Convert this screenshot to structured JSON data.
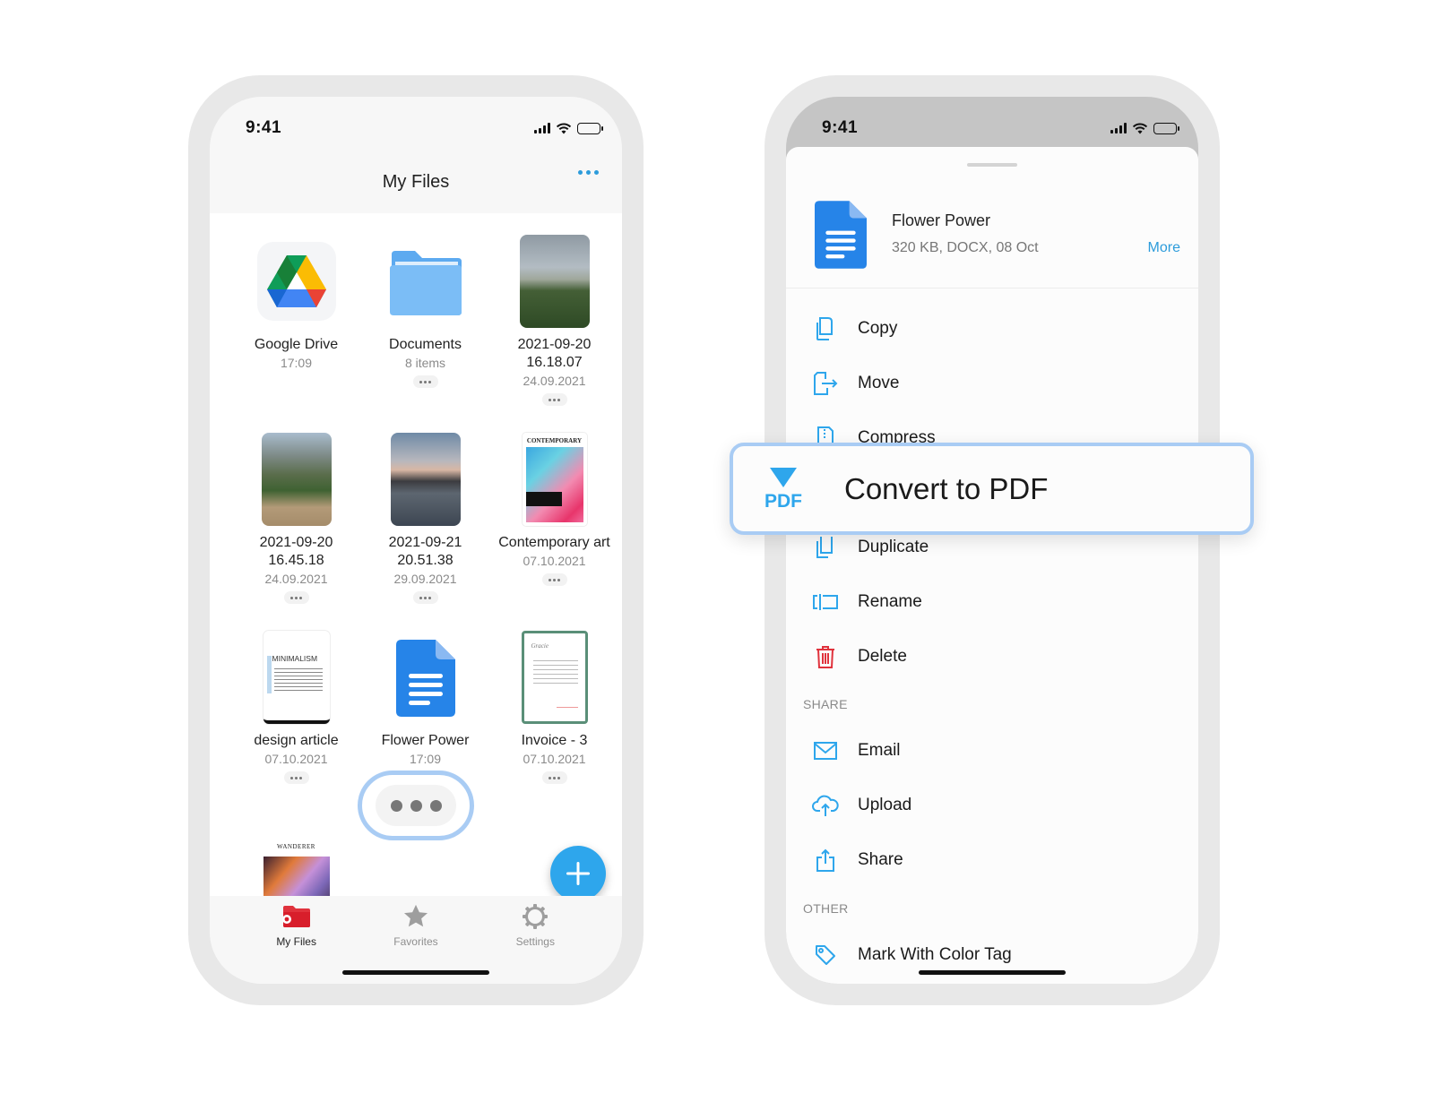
{
  "status": {
    "time": "9:41"
  },
  "left_phone": {
    "nav": {
      "title": "My Files",
      "more_icon": "ellipsis-icon"
    },
    "files": [
      {
        "name": "Google Drive",
        "meta": "17:09",
        "type": "google-drive",
        "has_menu": false
      },
      {
        "name": "Documents",
        "meta": "8 items",
        "type": "folder",
        "has_menu": true
      },
      {
        "name": "2021-09-20 16.18.07",
        "meta": "24.09.2021",
        "type": "photo-hedge",
        "has_menu": true
      },
      {
        "name": "2021-09-20 16.45.18",
        "meta": "24.09.2021",
        "type": "photo-garden",
        "has_menu": true
      },
      {
        "name": "2021-09-21 20.51.38",
        "meta": "29.09.2021",
        "type": "photo-river",
        "has_menu": true
      },
      {
        "name": "Contemporary art",
        "meta": "07.10.2021",
        "type": "magazine-contemporary",
        "has_menu": true,
        "cover_title": "CONTEMPORARY"
      },
      {
        "name": "design article",
        "meta": "07.10.2021",
        "type": "doc-minimalism",
        "has_menu": true,
        "cover_title": "MINIMALISM"
      },
      {
        "name": "Flower Power",
        "meta": "17:09",
        "type": "google-doc",
        "has_menu": false
      },
      {
        "name": "Invoice - 3",
        "meta": "07.10.2021",
        "type": "invoice",
        "has_menu": true
      },
      {
        "name": "",
        "meta": "",
        "type": "magazine-wanderer",
        "has_menu": false,
        "cover_title": "WANDERER"
      }
    ],
    "highlight_menu_icon": "ellipsis-icon",
    "fab_icon": "plus-icon",
    "tabs": [
      {
        "label": "My Files",
        "icon": "folder-icon",
        "active": true
      },
      {
        "label": "Favorites",
        "icon": "star-icon",
        "active": false
      },
      {
        "label": "Settings",
        "icon": "gear-icon",
        "active": false
      }
    ]
  },
  "right_phone": {
    "file": {
      "name": "Flower Power",
      "details": "320 KB, DOCX, 08 Oct",
      "more_label": "More"
    },
    "actions": [
      {
        "label": "Copy",
        "icon": "copy-icon"
      },
      {
        "label": "Move",
        "icon": "move-icon"
      },
      {
        "label": "Compress",
        "icon": "zip-icon"
      },
      {
        "label": "Duplicate",
        "icon": "duplicate-icon"
      },
      {
        "label": "Rename",
        "icon": "rename-icon"
      },
      {
        "label": "Delete",
        "icon": "trash-icon"
      }
    ],
    "share_section": "SHARE",
    "share_actions": [
      {
        "label": "Email",
        "icon": "mail-icon"
      },
      {
        "label": "Upload",
        "icon": "cloud-upload-icon"
      },
      {
        "label": "Share",
        "icon": "share-icon"
      }
    ],
    "other_section": "OTHER",
    "other_actions": [
      {
        "label": "Mark With Color Tag",
        "icon": "tag-icon"
      }
    ],
    "callout": {
      "label": "Convert to PDF",
      "icon_text": "PDF"
    }
  },
  "colors": {
    "accent": "#2ea6ec",
    "link": "#2d9cdb",
    "highlight_border": "#a9ccf4",
    "delete_red": "#e0323c",
    "doc_blue": "#2684e8"
  }
}
